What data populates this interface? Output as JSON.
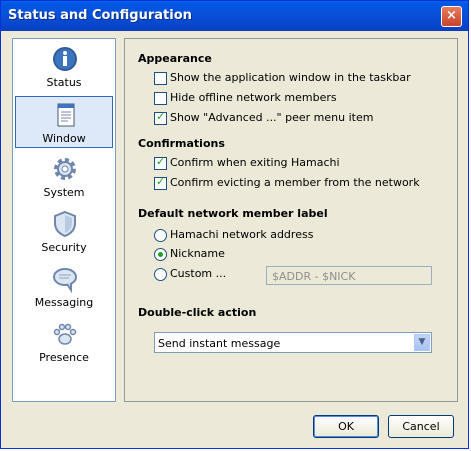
{
  "window": {
    "title": "Status and Configuration",
    "close_label": "×"
  },
  "sidebar": {
    "items": [
      {
        "label": "Status",
        "icon": "info-icon"
      },
      {
        "label": "Window",
        "icon": "window-icon",
        "selected": true
      },
      {
        "label": "System",
        "icon": "gear-icon"
      },
      {
        "label": "Security",
        "icon": "shield-icon"
      },
      {
        "label": "Messaging",
        "icon": "chat-bubble-icon"
      },
      {
        "label": "Presence",
        "icon": "paw-icon"
      }
    ]
  },
  "appearance": {
    "heading": "Appearance",
    "options": [
      {
        "label": "Show the application window in the taskbar",
        "checked": false
      },
      {
        "label": "Hide offline network members",
        "checked": false
      },
      {
        "label": "Show \"Advanced ...\" peer menu item",
        "checked": true
      }
    ]
  },
  "confirmations": {
    "heading": "Confirmations",
    "options": [
      {
        "label": "Confirm when exiting Hamachi",
        "checked": true
      },
      {
        "label": "Confirm evicting a member from the network",
        "checked": true
      }
    ]
  },
  "member_label": {
    "heading": "Default network member label",
    "options": [
      {
        "label": "Hamachi network address",
        "selected": false
      },
      {
        "label": "Nickname",
        "selected": true
      },
      {
        "label": "Custom ...",
        "selected": false
      }
    ],
    "custom_value": "$ADDR - $NICK"
  },
  "double_click": {
    "heading": "Double-click action",
    "selected": "Send instant message"
  },
  "buttons": {
    "ok": "OK",
    "cancel": "Cancel"
  }
}
